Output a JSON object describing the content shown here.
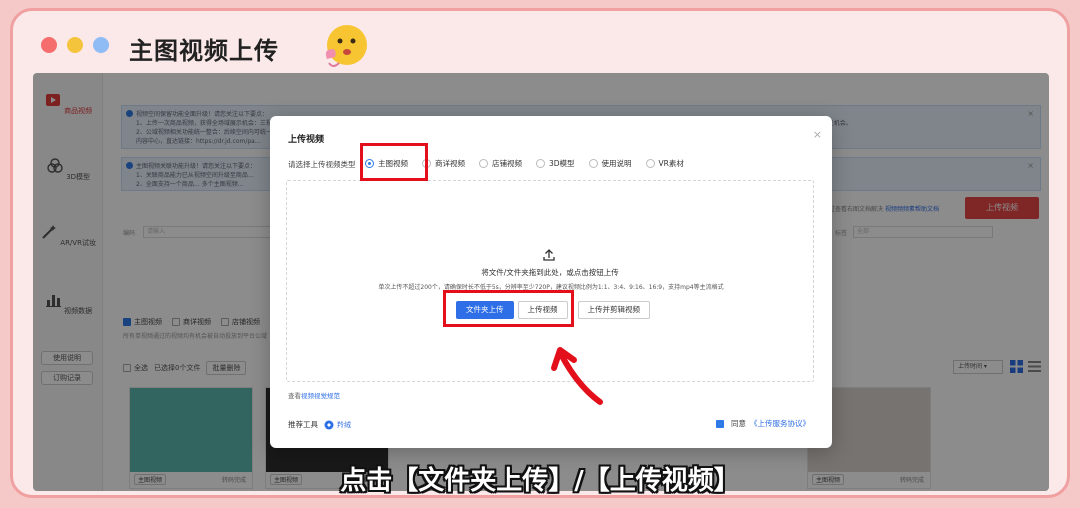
{
  "frame": {
    "title": "主图视频上传",
    "dots": [
      "#f56d6d",
      "#f5c43d",
      "#8fbcf5"
    ]
  },
  "sidebar": {
    "items": [
      {
        "label": "商品视频",
        "icon": "video-icon",
        "active": true
      },
      {
        "label": "3D模型",
        "icon": "cube-icon"
      },
      {
        "label": "AR/VR试妆",
        "icon": "magic-wand-icon"
      },
      {
        "label": "视频数据",
        "icon": "bar-chart-icon"
      }
    ],
    "buttons": [
      "使用说明",
      "订购记录"
    ]
  },
  "background": {
    "notice1": {
      "line1": "视频空间保留功能全面升级！请您关注以下要点：",
      "line2": "1、上传一次商品视频，获得全场域展示机会：三视频您成功关联到商品上的所有视频（主图视频，商详视频）均有机会自动投放更多流量场域，无需再手动投放至公域！ 正常注意自动为您的视频补充用户可能喜欢的封面/标题信息，无需手动填写即可提升公域曝光机会。",
      "line3": "2、公域视频相关功能统一整合：后续空间内可统一查看…",
      "line4": "内容中心，直达链接：https://dr.jd.com/pa…"
    },
    "notice2": {
      "line1": "主图视频关联功能升级！请您关注以下要点：",
      "line2": "1、关联商品能力已从视频空间升级至商品…",
      "line3": "2、全面支持一个商品… 多个主图视频…"
    },
    "upload_button": "上传视频",
    "doc_link": "通过查看右图文档解决",
    "doc_link_blue": "视频频频素帮助文档",
    "filter_label": "编码",
    "filter_placeholder": "请输入",
    "tag_label": "标签",
    "tag_placeholder": "全部",
    "tabs": [
      "主图视频",
      "商详视频",
      "店铺视频"
    ],
    "tabs_hint": "所有单视频通过的视频均有机会被自动投放到平台公域",
    "select_all": "全选",
    "selected_count": "已选择0个文件",
    "batch_delete": "批量删除",
    "sort": "上传时间",
    "thumbs": [
      {
        "tag": "主图视频",
        "status": "转码完成",
        "color": "#5bb8b0"
      },
      {
        "tag": "主图视频",
        "status": "转码完成",
        "color": "#2f2f2f"
      },
      {
        "tag": "主图视频",
        "status": "转码完成",
        "color": "#d9d2cc"
      }
    ]
  },
  "modal": {
    "title": "上传视频",
    "close": "×",
    "type_label": "请选择上传视频类型",
    "types": [
      {
        "label": "主图视频",
        "checked": true
      },
      {
        "label": "商详视频",
        "checked": false
      },
      {
        "label": "店铺视频",
        "checked": false
      },
      {
        "label": "3D模型",
        "checked": false
      },
      {
        "label": "使用说明",
        "checked": false
      },
      {
        "label": "VR素材",
        "checked": false
      }
    ],
    "drop_text": "将文件/文件夹拖到此处，或点击按钮上传",
    "drop_hint": "单次上传不超过200个，请确保时长不低于5s，分辨率至少720P，建议视频比例为1:1、3:4、9:16、16:9，支持mp4等主流格式",
    "btn_folder": "文件夹上传",
    "btn_video": "上传视频",
    "btn_edit": "上传并剪辑视频",
    "help_prefix": "查看",
    "help_link": "视频视觉规范",
    "tools_label": "推荐工具",
    "tool_name": "羚绒",
    "agree_prefix": "同意",
    "agree_link": "《上传服务协议》"
  },
  "caption": "点击【文件夹上传】/【上传视频】",
  "colors": {
    "accent": "#2e6ee6",
    "highlight": "#e3101c",
    "primary_red": "#e84545"
  }
}
